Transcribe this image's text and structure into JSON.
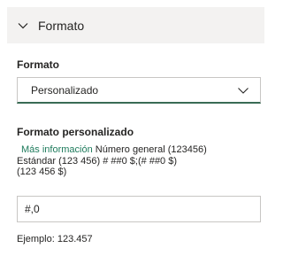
{
  "section": {
    "title": "Formato",
    "expanded": true
  },
  "format": {
    "label": "Formato",
    "selected_value": "Personalizado"
  },
  "custom_format": {
    "label": "Formato personalizado",
    "link_text": "Más información",
    "desc_line1": "Número general (123456)",
    "desc_line2": "Estándar (123 456) # ##0 $;(# ##0 $)",
    "desc_line3": "(123 456 $)",
    "input_value": "#,0",
    "example": "Ejemplo: 123.457"
  },
  "colors": {
    "header_bg": "#f3f2f1",
    "accent_underline": "#3a6b55",
    "link": "#1e7b5c"
  },
  "icons": {
    "section_toggle": "chevron-down-icon",
    "dropdown": "chevron-down-icon"
  }
}
